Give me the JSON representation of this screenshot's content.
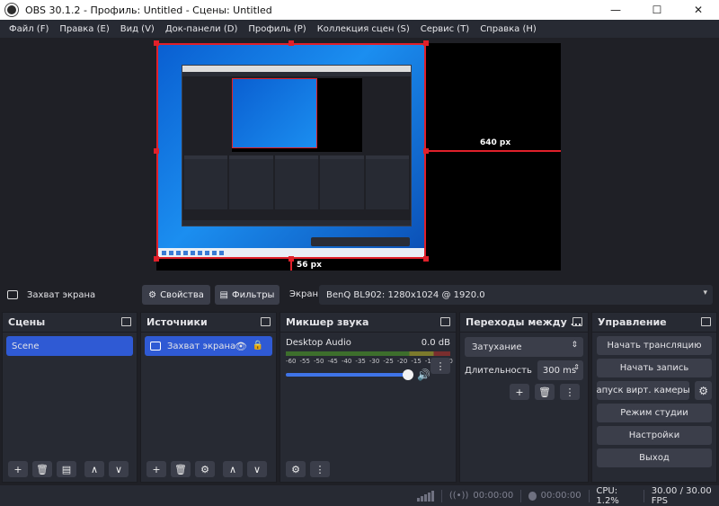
{
  "window": {
    "title": "OBS 30.1.2 - Профиль: Untitled - Сцены: Untitled",
    "minimize": "—",
    "maximize": "☐",
    "close": "✕"
  },
  "menu": [
    "Файл (F)",
    "Правка (E)",
    "Вид (V)",
    "Док-панели (D)",
    "Профиль (P)",
    "Коллекция сцен (S)",
    "Сервис (T)",
    "Справка (H)"
  ],
  "preview": {
    "horizontal_guide_label": "640 px",
    "vertical_guide_label": "56 px"
  },
  "source_toolbar": {
    "selected_source": "Захват экрана",
    "properties_label": "Свойства",
    "filters_label": "Фильтры",
    "screen_label": "Экран",
    "screen_value": "BenQ BL902: 1280x1024 @ 1920.0"
  },
  "docks": {
    "scenes": {
      "title": "Сцены",
      "items": [
        "Scene"
      ]
    },
    "sources": {
      "title": "Источники",
      "items": [
        {
          "name": "Захват экрана"
        }
      ]
    },
    "mixer": {
      "title": "Микшер звука",
      "track_name": "Desktop Audio",
      "level": "0.0 dB",
      "scale": [
        "-60",
        "-55",
        "-50",
        "-45",
        "-40",
        "-35",
        "-30",
        "-25",
        "-20",
        "-15",
        "-10",
        "-5",
        "0"
      ],
      "volume": 1.0
    },
    "transitions": {
      "title": "Переходы между ...",
      "transition": "Затухание",
      "duration_label": "Длительность",
      "duration_value": "300 ms"
    },
    "controls": {
      "title": "Управление",
      "start_stream": "Начать трансляцию",
      "start_record": "Начать запись",
      "virtual_cam": "апуск вирт. камеры",
      "studio_mode": "Режим студии",
      "settings": "Настройки",
      "exit": "Выход"
    }
  },
  "status": {
    "stream_time": "00:00:00",
    "record_time": "00:00:00",
    "cpu": "CPU: 1.2%",
    "fps": "30.00 / 30.00 FPS"
  },
  "colors": {
    "accent": "#2f5ad4",
    "selection_red": "#e0202a",
    "panel": "#272a33",
    "background": "#1f2026"
  },
  "icons": {
    "add": "+",
    "remove": "🗑",
    "up": "∧",
    "down": "∨",
    "gear": "⚙",
    "more": "⋮",
    "eye": "👁",
    "lock": "🔒",
    "speaker": "🔊"
  }
}
